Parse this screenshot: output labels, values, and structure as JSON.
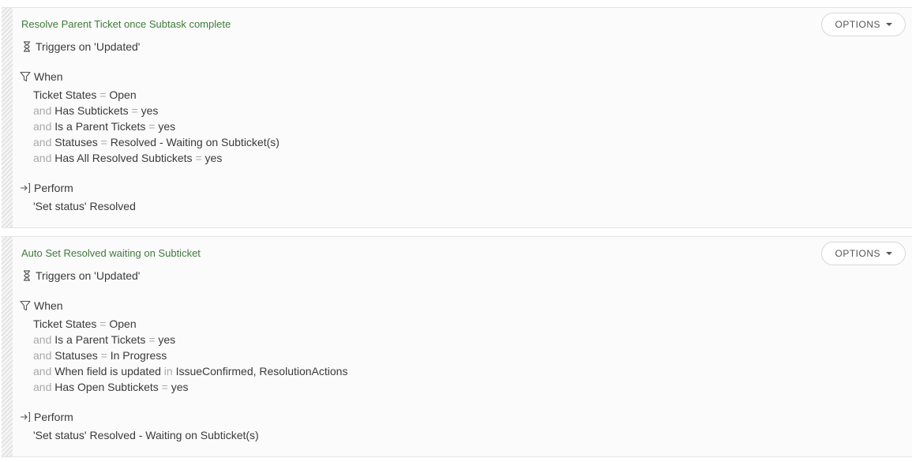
{
  "rules": [
    {
      "title": "Resolve Parent Ticket once Subtask complete",
      "options_label": "OPTIONS",
      "trigger_label": "Triggers on 'Updated'",
      "when_label": "When",
      "conditions": [
        {
          "conj": "",
          "field": "Ticket States",
          "op": "=",
          "value": "Open"
        },
        {
          "conj": "and",
          "field": "Has Subtickets",
          "op": "=",
          "value": "yes"
        },
        {
          "conj": "and",
          "field": "Is a Parent Tickets",
          "op": "=",
          "value": "yes"
        },
        {
          "conj": "and",
          "field": "Statuses",
          "op": "=",
          "value": "Resolved - Waiting on Subticket(s)"
        },
        {
          "conj": "and",
          "field": "Has All Resolved Subtickets",
          "op": "=",
          "value": "yes"
        }
      ],
      "perform_label": "Perform",
      "action": "'Set status' Resolved"
    },
    {
      "title": "Auto Set Resolved waiting on Subticket",
      "options_label": "OPTIONS",
      "trigger_label": "Triggers on 'Updated'",
      "when_label": "When",
      "conditions": [
        {
          "conj": "",
          "field": "Ticket States",
          "op": "=",
          "value": "Open"
        },
        {
          "conj": "and",
          "field": "Is a Parent Tickets",
          "op": "=",
          "value": "yes"
        },
        {
          "conj": "and",
          "field": "Statuses",
          "op": "=",
          "value": "In Progress"
        },
        {
          "conj": "and",
          "field": "When field is updated",
          "op": "in",
          "value": "IssueConfirmed, ResolutionActions"
        },
        {
          "conj": "and",
          "field": "Has Open Subtickets",
          "op": "=",
          "value": "yes"
        }
      ],
      "perform_label": "Perform",
      "action": "'Set status' Resolved - Waiting on Subticket(s)"
    }
  ],
  "colors": {
    "title": "#3f7a3a",
    "muted": "#a9a9a9",
    "text": "#3a3a3a"
  }
}
